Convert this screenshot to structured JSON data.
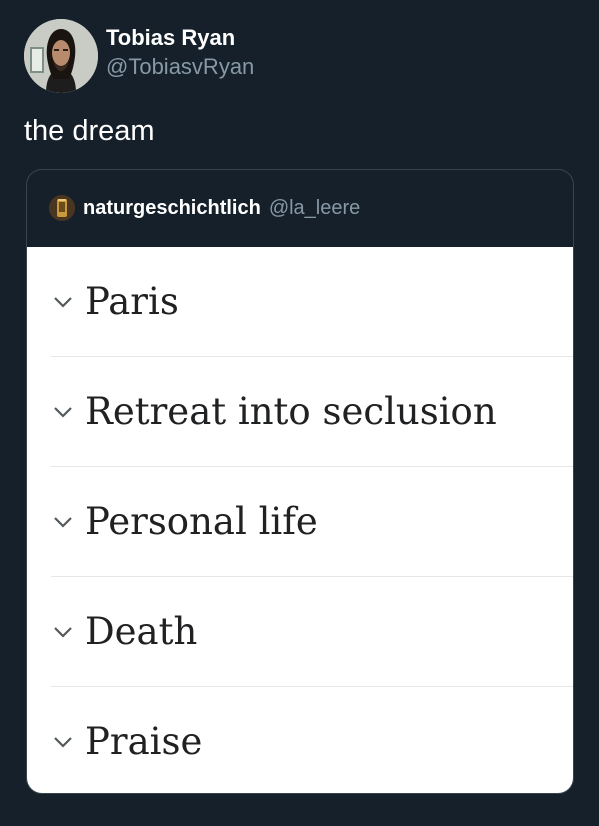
{
  "tweet": {
    "author": {
      "display_name": "Tobias Ryan",
      "handle": "@TobiasvRyan",
      "avatar_icon": "profile-photo"
    },
    "text": "the dream"
  },
  "quoted_tweet": {
    "author": {
      "display_name": "naturgeschichtlich",
      "handle": "@la_leere",
      "avatar_icon": "profile-photo"
    },
    "media": {
      "sections": [
        {
          "label": "Paris",
          "icon": "chevron-down-icon"
        },
        {
          "label": "Retreat into seclusion",
          "icon": "chevron-down-icon"
        },
        {
          "label": "Personal life",
          "icon": "chevron-down-icon"
        },
        {
          "label": "Death",
          "icon": "chevron-down-icon"
        },
        {
          "label": "Praise",
          "icon": "chevron-down-icon"
        }
      ]
    }
  },
  "colors": {
    "background": "#15202b",
    "secondary_text": "#8899a6",
    "card_border": "#38444d",
    "media_background": "#ffffff",
    "media_text": "#202122"
  }
}
